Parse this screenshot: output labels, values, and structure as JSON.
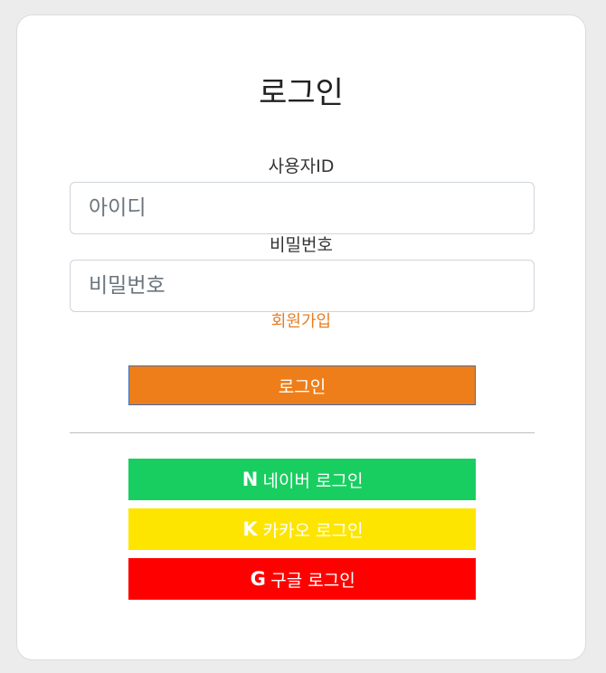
{
  "colors": {
    "page_bg": "#ececec",
    "card_bg": "#ffffff",
    "accent_orange": "#ee7e1a",
    "signup_orange": "#e67e22",
    "naver_green": "#19ce60",
    "kakao_yellow": "#fee500",
    "google_red": "#ff0000"
  },
  "title": "로그인",
  "form": {
    "id_label": "사용자ID",
    "id_placeholder": "아이디",
    "id_value": "",
    "pw_label": "비밀번호",
    "pw_placeholder": "비밀번호",
    "pw_value": "",
    "signup_link": "회원가입",
    "login_button": "로그인"
  },
  "social": {
    "naver": {
      "icon_name": "naver-n-icon",
      "icon_glyph": "N",
      "label": "네이버 로그인"
    },
    "kakao": {
      "icon_name": "kakao-k-icon",
      "icon_glyph": "K",
      "label": "카카오 로그인"
    },
    "google": {
      "icon_name": "google-g-icon",
      "icon_glyph": "G",
      "label": "구글 로그인"
    }
  }
}
